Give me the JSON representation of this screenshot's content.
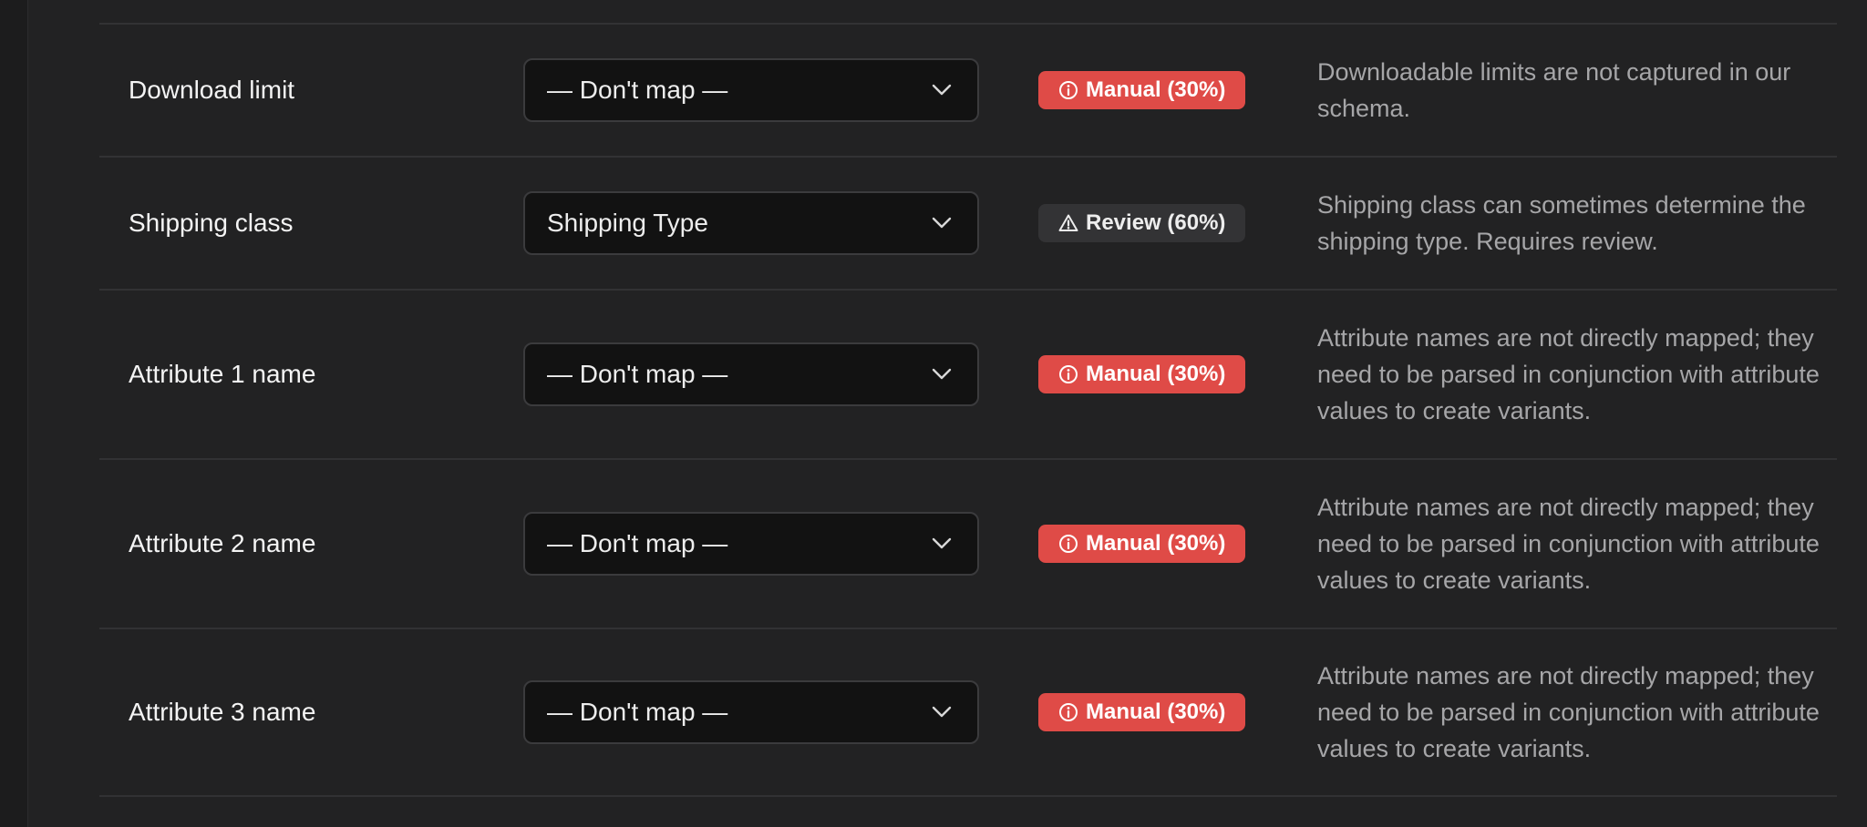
{
  "colors": {
    "background": "#222223",
    "manual_badge": "#df4b47",
    "review_badge": "#333335",
    "note_text": "#a6a6a8"
  },
  "rows": [
    {
      "field": "Download limit",
      "mapping": "— Don't map —",
      "badge_type": "manual",
      "badge_icon": "info-icon",
      "badge": "Manual (30%)",
      "note": "Downloadable limits are not captured in our schema."
    },
    {
      "field": "Shipping class",
      "mapping": "Shipping Type",
      "badge_type": "review",
      "badge_icon": "warning-icon",
      "badge": "Review (60%)",
      "note": "Shipping class can sometimes determine the shipping type. Requires review."
    },
    {
      "field": "Attribute 1 name",
      "mapping": "— Don't map —",
      "badge_type": "manual",
      "badge_icon": "info-icon",
      "badge": "Manual (30%)",
      "note": "Attribute names are not directly mapped; they need to be parsed in conjunction with attribute values to create variants."
    },
    {
      "field": "Attribute 2 name",
      "mapping": "— Don't map —",
      "badge_type": "manual",
      "badge_icon": "info-icon",
      "badge": "Manual (30%)",
      "note": "Attribute names are not directly mapped; they need to be parsed in conjunction with attribute values to create variants."
    },
    {
      "field": "Attribute 3 name",
      "mapping": "— Don't map —",
      "badge_type": "manual",
      "badge_icon": "info-icon",
      "badge": "Manual (30%)",
      "note": "Attribute names are not directly mapped; they need to be parsed in conjunction with attribute values to create variants."
    }
  ]
}
